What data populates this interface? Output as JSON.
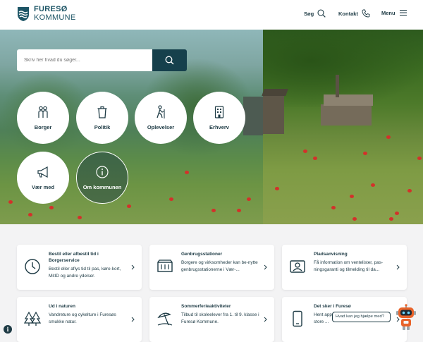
{
  "header": {
    "logo_line1": "FURESØ",
    "logo_line2": "KOMMUNE",
    "search_label": "Søg",
    "contact_label": "Kontakt",
    "menu_label": "Menu"
  },
  "search": {
    "placeholder": "Skriv her hvad du søger..."
  },
  "topics": [
    {
      "label": "Borger",
      "icon": "people-icon"
    },
    {
      "label": "Politik",
      "icon": "bin-icon"
    },
    {
      "label": "Oplevelser",
      "icon": "hiker-icon"
    },
    {
      "label": "Erhverv",
      "icon": "building-icon"
    },
    {
      "label": "Vær med",
      "icon": "megaphone-icon"
    },
    {
      "label": "Om kommunen",
      "icon": "info-icon"
    }
  ],
  "cards": [
    {
      "title": "Bestil eller afbestil tid i Borgerservice",
      "desc": "Bestil eller aflys tid til pas, køre-kort, MitID og andre ydelser.",
      "icon": "clock-icon"
    },
    {
      "title": "Genbrugsstationer",
      "desc": "Borgere og virksomheder kan be-nytte genbrugsstationerne i Vær-...",
      "icon": "container-icon"
    },
    {
      "title": "Pladsanvisning",
      "desc": "Få information om ventelister, pas-ningsgaranti og tilmelding til da...",
      "icon": "child-photo-icon"
    },
    {
      "title": "Ud i naturen",
      "desc": "Vandreture og cykelture i Furesøs smukke natur.",
      "icon": "trees-icon"
    },
    {
      "title": "Sommerferieaktiviteter",
      "desc": "Tilbud til skoleelever fra 1. til 9. klasse i Furesø Kommune.",
      "icon": "parasol-icon"
    },
    {
      "title": "Det sker i Furesø",
      "desc": "Hent app... resø tilbyder aktiviteter for store ...",
      "icon": "phone-icon"
    }
  ],
  "chat": {
    "bubble": "Hvad kan jeg hjælpe med?"
  },
  "colors": {
    "brand": "#16404c",
    "poppy": "#d3312a",
    "background": "#f3f3f4"
  }
}
